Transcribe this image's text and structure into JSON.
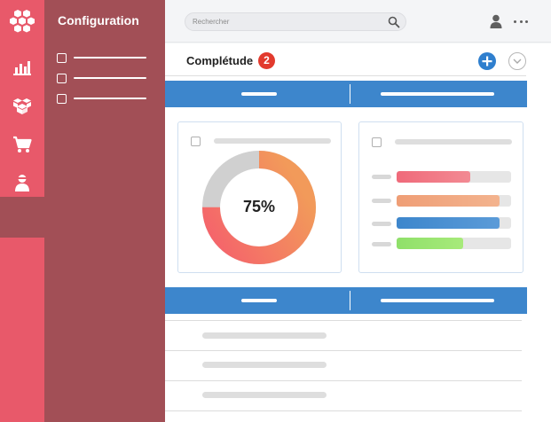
{
  "app": {
    "panel_title": "Configuration"
  },
  "topbar": {
    "search_placeholder": "Rechercher"
  },
  "main": {
    "heading": "Complétude",
    "badge_count": "2"
  },
  "donut_card": {
    "percent_label": "75%",
    "percent_value": 75
  },
  "progress_card": {
    "bars": [
      {
        "fill": 0.64,
        "color_from": "#f06a7a",
        "color_to": "#f28a93"
      },
      {
        "fill": 0.9,
        "color_from": "#ef9e76",
        "color_to": "#f3b38e"
      },
      {
        "fill": 0.9,
        "color_from": "#3d86cc",
        "color_to": "#5b9bd8"
      },
      {
        "fill": 0.58,
        "color_from": "#8fe06a",
        "color_to": "#a7ea7a"
      }
    ]
  },
  "colors": {
    "rail": "#e8596a",
    "panel": "#a24f56",
    "band": "#3d86cc",
    "badge": "#e23a2d",
    "donut_gradient_from": "#f5606c",
    "donut_gradient_to": "#f29a5a",
    "donut_remainder": "#d0d0d0"
  },
  "icons": {
    "logo": "hexagon-cluster-logo",
    "nav": [
      "bar-chart-icon",
      "boxes-icon",
      "cart-icon",
      "user-icon"
    ]
  }
}
